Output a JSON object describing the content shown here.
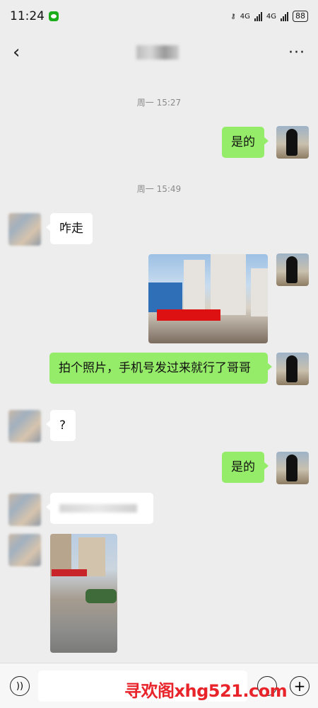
{
  "status_bar": {
    "time": "11:24",
    "network_1": "4G",
    "network_2": "4G",
    "battery": "88"
  },
  "nav": {
    "back_icon": "chevron-left-icon",
    "more_label": "···"
  },
  "messages": {
    "ts1": "周一 15:27",
    "m1": "是的",
    "ts2": "周一 15:49",
    "m2": "咋走",
    "m4": "拍个照片，手机号发过来就行了哥哥",
    "m5": "?",
    "m6": "是的"
  },
  "input_bar": {
    "voice_icon": "voice-icon",
    "emoji_icon": "emoji-icon",
    "plus_icon": "plus-icon"
  },
  "watermark": "寻欢阁xhg521.com"
}
